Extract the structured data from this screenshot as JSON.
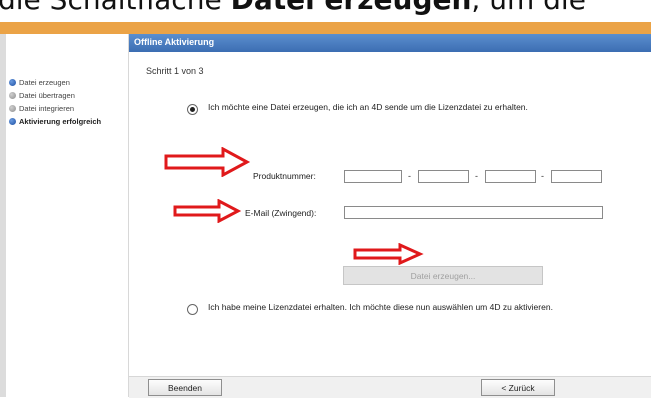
{
  "document": {
    "caption_before": "die Schaltfläche",
    "caption_bold": "Datei erzeugen",
    "caption_after": ", um die"
  },
  "wizard": {
    "title": "Offline Aktivierung",
    "steps": [
      {
        "label": "Datei erzeugen",
        "state": "current"
      },
      {
        "label": "Datei übertragen",
        "state": "pending"
      },
      {
        "label": "Datei integrieren",
        "state": "pending"
      },
      {
        "label": "Aktivierung erfolgreich",
        "state": "current"
      }
    ],
    "step_counter": "Schritt 1 von 3",
    "option_create": "Ich möchte eine Datei erzeugen, die ich an 4D sende um die Lizenzdatei zu erhalten.",
    "option_select": "Ich habe meine Lizenzdatei erhalten. Ich möchte diese nun auswählen um 4D zu aktivieren.",
    "product_label": "Produktnummer:",
    "product_separator": "-",
    "product_fields": [
      "",
      "",
      "",
      ""
    ],
    "email_label": "E-Mail (Zwingend):",
    "email_value": "",
    "create_button": "Datei erzeugen...",
    "quit_button": "Beenden",
    "back_button": "< Zurück"
  },
  "colors": {
    "accent_orange": "#eba346",
    "titlebar_blue": "#4a7cc0",
    "annotation_red": "#e0191b"
  },
  "icons": [
    "step-bullet-blue-icon",
    "step-bullet-grey-icon",
    "annotation-arrow-icon"
  ]
}
